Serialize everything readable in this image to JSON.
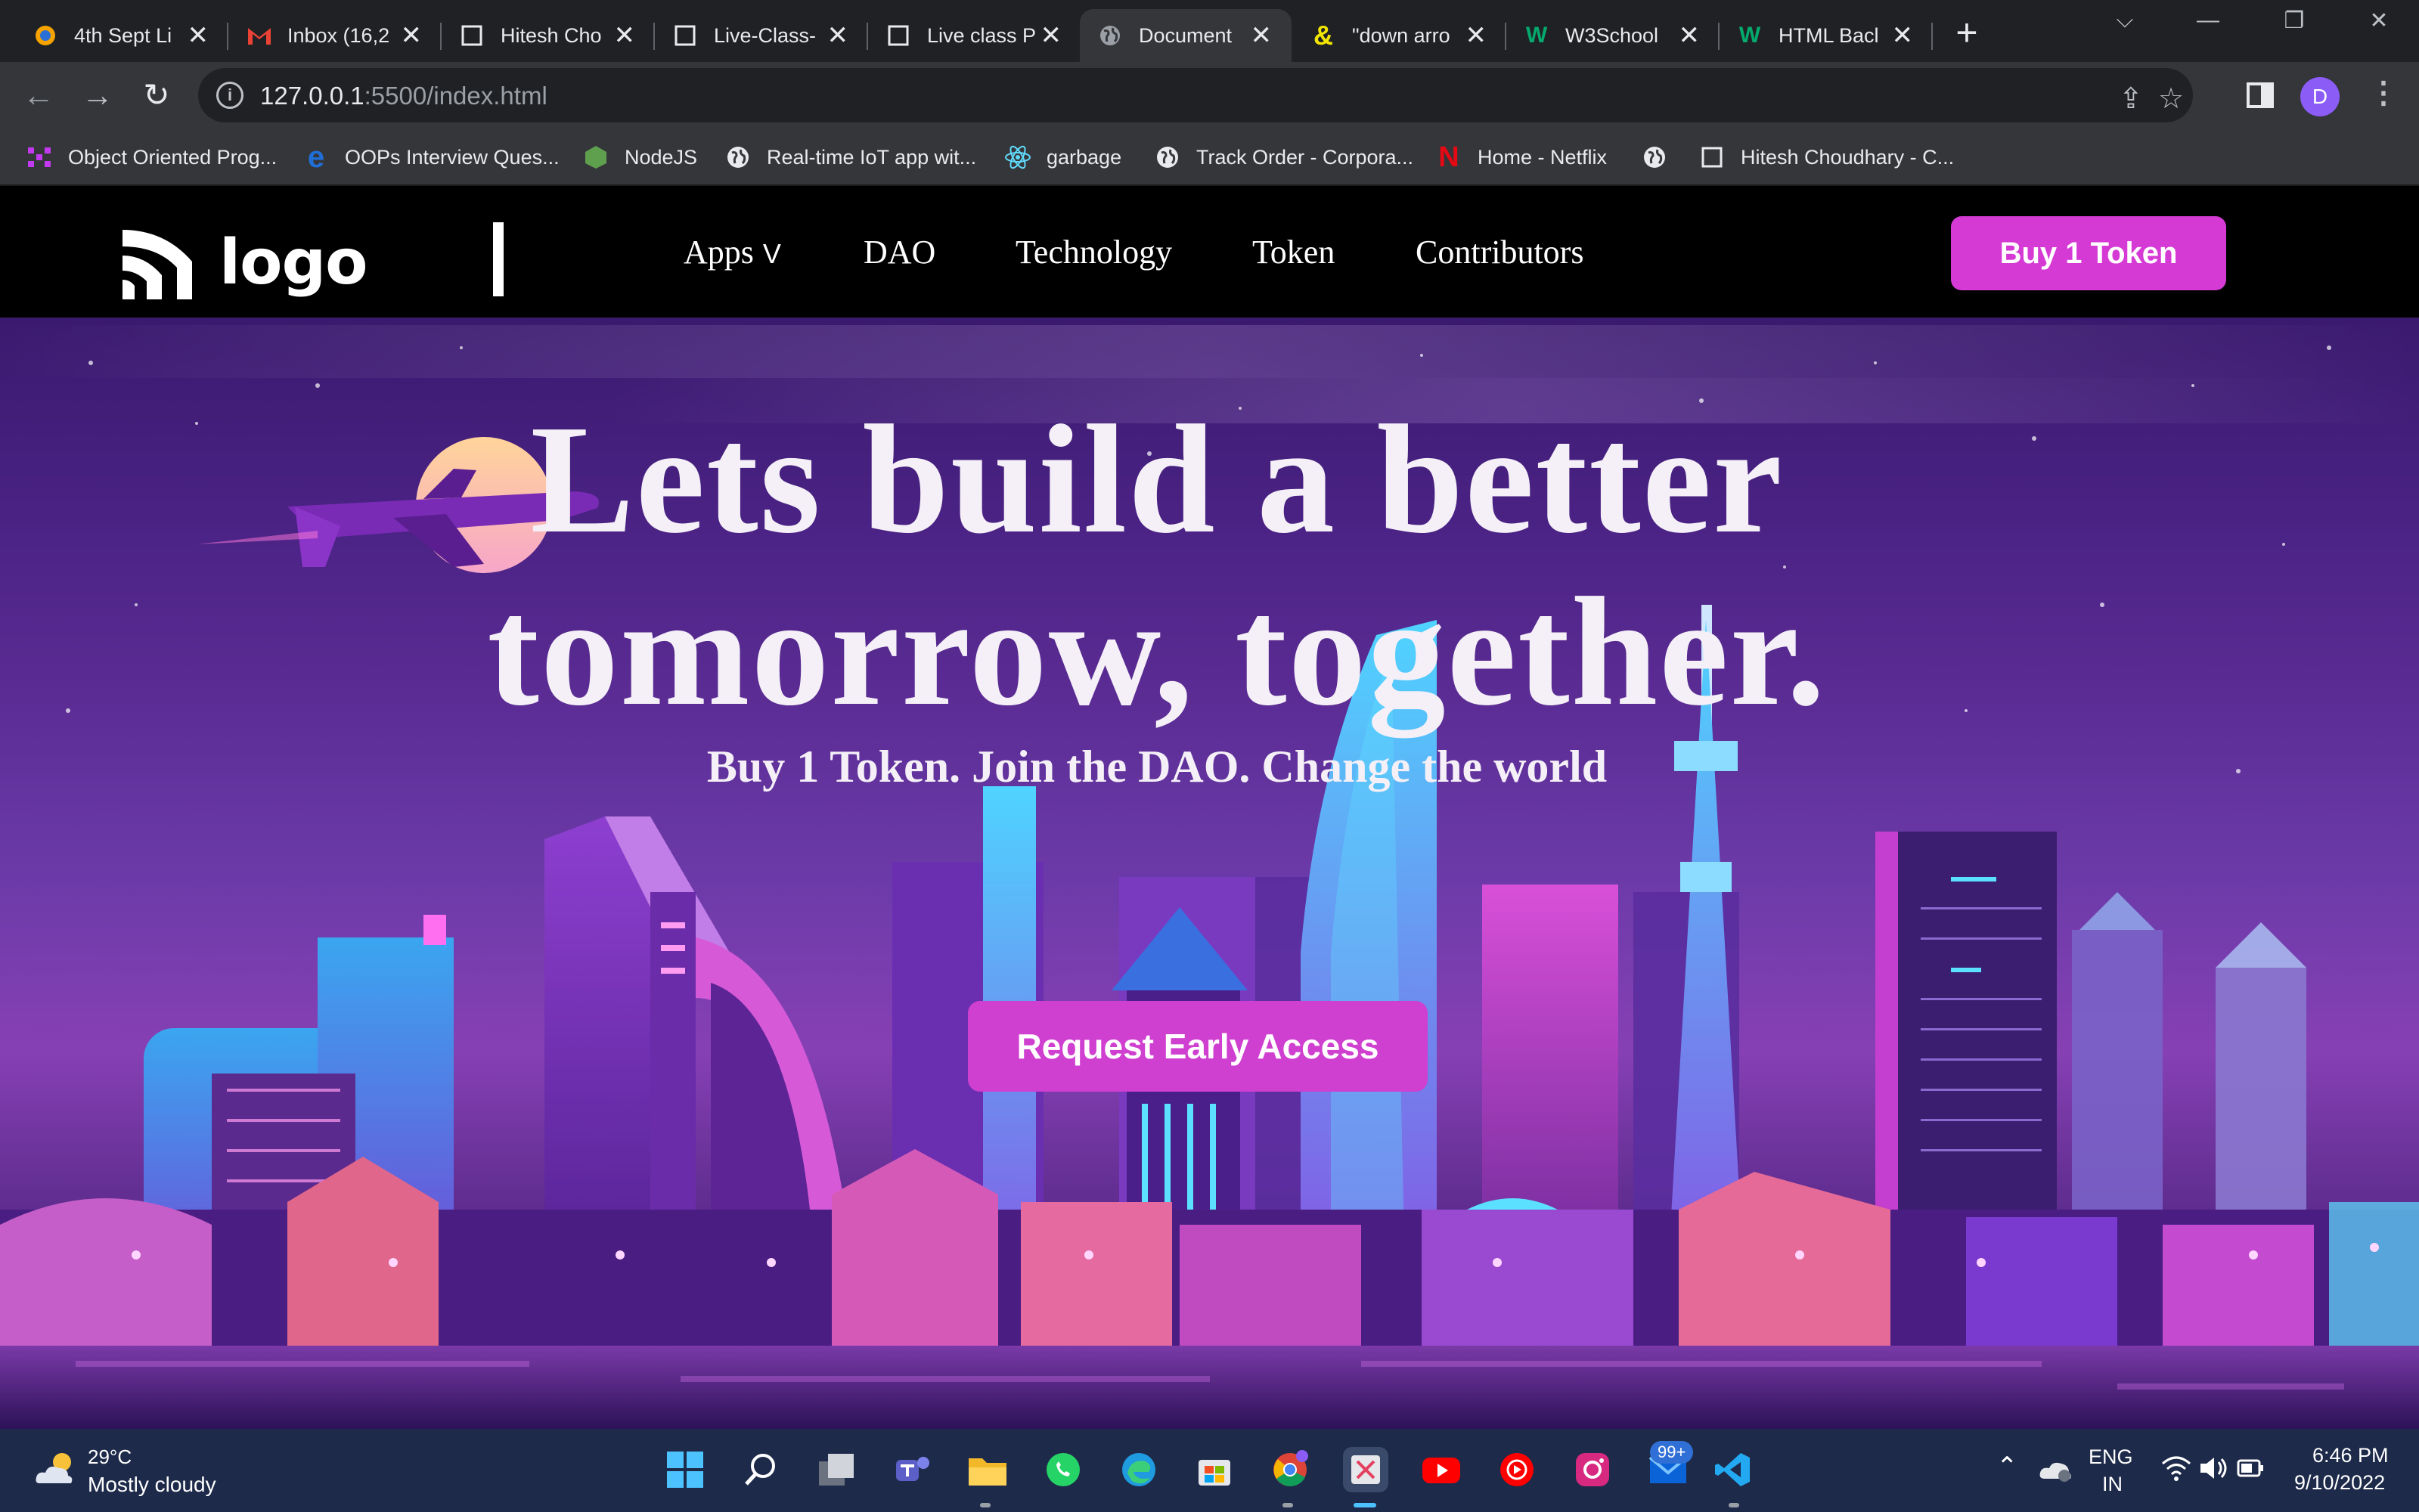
{
  "browser": {
    "tabs": [
      {
        "title": "4th Sept Li",
        "icon": "sun-orange-icon"
      },
      {
        "title": "Inbox (16,2",
        "icon": "gmail-icon"
      },
      {
        "title": "Hitesh Cho",
        "icon": "notion-icon"
      },
      {
        "title": "Live-Class-",
        "icon": "notion-icon"
      },
      {
        "title": "Live class P",
        "icon": "notion-icon"
      },
      {
        "title": "Document",
        "icon": "globe-icon",
        "active": true
      },
      {
        "title": "\"down arro",
        "icon": "ampersand-icon"
      },
      {
        "title": "W3School",
        "icon": "w3schools-icon"
      },
      {
        "title": "HTML Bacl",
        "icon": "w3schools-icon"
      }
    ],
    "new_tab": "+",
    "window_controls": {
      "dropdown": "⌵",
      "minimize": "—",
      "restore": "❐",
      "close": "✕"
    },
    "address": {
      "host": "127.0.0.1",
      "rest": ":5500/index.html"
    },
    "profile_initial": "D",
    "bookmarks": [
      {
        "title": "Object Oriented Prog...",
        "icon": "grid-icon"
      },
      {
        "title": "OOPs Interview Ques...",
        "icon": "e-icon"
      },
      {
        "title": "NodeJS",
        "icon": "nodejs-icon"
      },
      {
        "title": "Real-time IoT app wit...",
        "icon": "globe-icon"
      },
      {
        "title": "garbage",
        "icon": "react-icon"
      },
      {
        "title": "Track Order - Corpora...",
        "icon": "globe-icon"
      },
      {
        "title": "Home - Netflix",
        "icon": "netflix-icon"
      },
      {
        "title": "",
        "icon": "globe-icon"
      },
      {
        "title": "Hitesh Choudhary - C...",
        "icon": "notion-icon"
      }
    ]
  },
  "site": {
    "logo_text": "logo",
    "nav": [
      {
        "label": "Apps",
        "caret": "V"
      },
      {
        "label": "DAO"
      },
      {
        "label": "Technology"
      },
      {
        "label": "Token"
      },
      {
        "label": "Contributors"
      }
    ],
    "buy_button": "Buy 1 Token",
    "hero": {
      "title_line1": "Lets build a better",
      "title_line2": "tomorrow, together.",
      "subtitle": "Buy 1 Token. Join the DAO. Change the world",
      "cta": "Request Early Access"
    },
    "colors": {
      "accent": "#d63ad5",
      "nav_bg": "#000000",
      "hero_text": "#f5f0f7"
    }
  },
  "taskbar": {
    "weather": {
      "temp": "29°C",
      "desc": "Mostly cloudy"
    },
    "apps": [
      "windows-start-icon",
      "search-icon",
      "task-view-icon",
      "teams-icon",
      "file-explorer-icon",
      "whatsapp-icon",
      "edge-icon",
      "store-icon",
      "chrome-icon",
      "snipping-tool-icon",
      "youtube-icon",
      "youtube-music-icon",
      "instagram-icon",
      "mail-icon",
      "vscode-icon"
    ],
    "badge": "99+",
    "lang": {
      "line1": "ENG",
      "line2": "IN"
    },
    "time": "6:46 PM",
    "date": "9/10/2022"
  }
}
